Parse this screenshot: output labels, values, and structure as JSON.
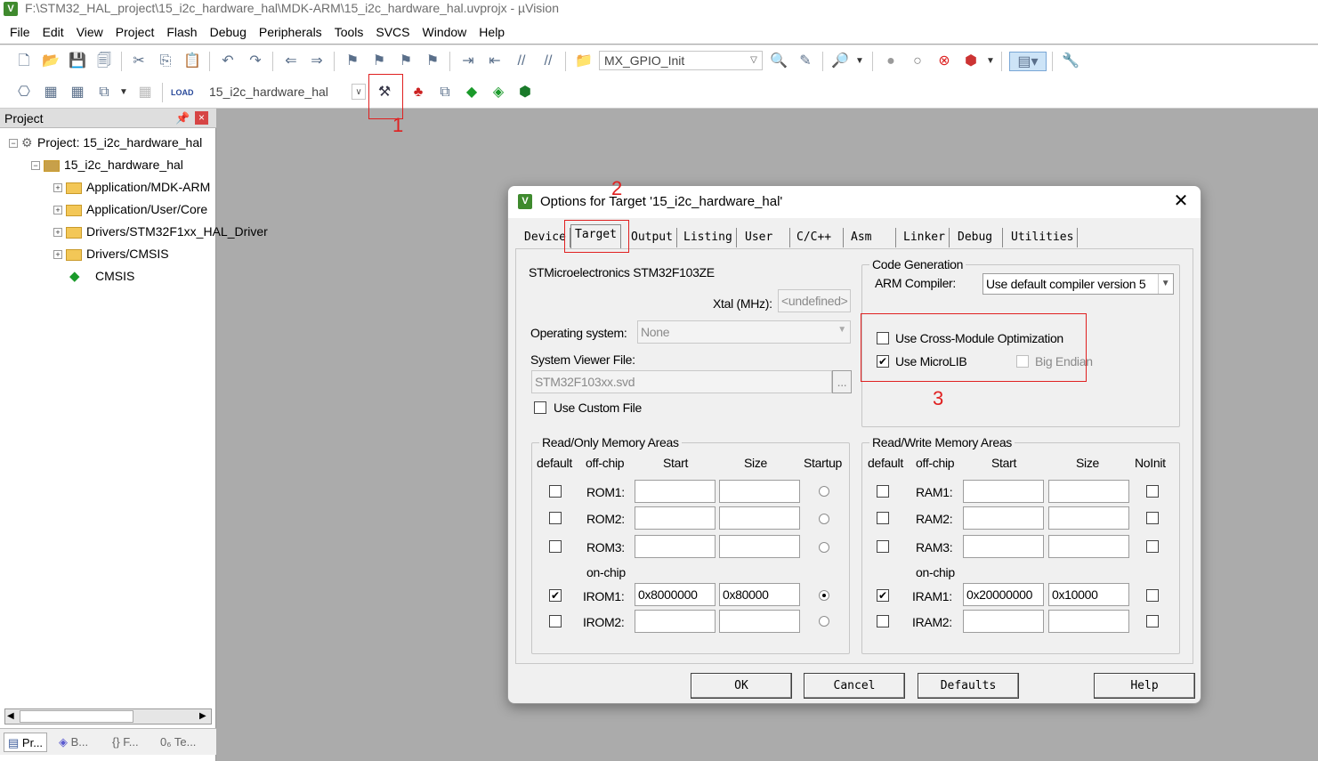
{
  "window": {
    "title": "F:\\STM32_HAL_project\\15_i2c_hardware_hal\\MDK-ARM\\15_i2c_hardware_hal.uvprojx - µVision",
    "icon_text": "V"
  },
  "menu": [
    "File",
    "Edit",
    "View",
    "Project",
    "Flash",
    "Debug",
    "Peripherals",
    "Tools",
    "SVCS",
    "Window",
    "Help"
  ],
  "toolbar": {
    "function_combo": "MX_GPIO_Init",
    "target_combo": "15_i2c_hardware_hal",
    "load_label": "LOAD"
  },
  "project_panel": {
    "title": "Project",
    "pin": "ᵖ",
    "close": "×",
    "tree": [
      {
        "label": "Project: 15_i2c_hardware_hal",
        "expander": "−"
      },
      {
        "label": "15_i2c_hardware_hal",
        "expander": "−"
      },
      {
        "label": "Application/MDK-ARM",
        "expander": "+"
      },
      {
        "label": "Application/User/Core",
        "expander": "+"
      },
      {
        "label": "Drivers/STM32F1xx_HAL_Driver",
        "expander": "+"
      },
      {
        "label": "Drivers/CMSIS",
        "expander": "+"
      },
      {
        "label": "CMSIS",
        "expander": ""
      }
    ],
    "bottom_tabs": [
      "Pr...",
      "B...",
      "{} F...",
      "0₆ Te..."
    ]
  },
  "annotations": [
    "1",
    "2",
    "3"
  ],
  "dialog": {
    "title": "Options for Target '15_i2c_hardware_hal'",
    "close": "✕",
    "tabs": [
      "Device",
      "Target",
      "Output",
      "Listing",
      "User",
      "C/C++",
      "Asm",
      "Linker",
      "Debug",
      "Utilities"
    ],
    "active_tab": "Target",
    "device": "STMicroelectronics STM32F103ZE",
    "xtal_label": "Xtal (MHz):",
    "xtal_value": "<undefined>",
    "os_label": "Operating system:",
    "os_value": "None",
    "svd_label": "System Viewer File:",
    "svd_value": "STM32F103xx.svd",
    "browse": "...",
    "custom_file": "Use Custom File",
    "code_gen": {
      "title": "Code Generation",
      "compiler_label": "ARM Compiler:",
      "compiler_value": "Use default compiler version 5",
      "cross_module": "Use Cross-Module Optimization",
      "microlib": "Use MicroLIB",
      "big_endian": "Big Endian"
    },
    "ro_memory": {
      "title": "Read/Only Memory Areas",
      "headers": [
        "default",
        "off-chip",
        "Start",
        "Size",
        "Startup"
      ],
      "on_chip_label": "on-chip",
      "rows": [
        {
          "name": "ROM1:",
          "start": "",
          "size": ""
        },
        {
          "name": "ROM2:",
          "start": "",
          "size": ""
        },
        {
          "name": "ROM3:",
          "start": "",
          "size": ""
        },
        {
          "name": "IROM1:",
          "start": "0x8000000",
          "size": "0x80000"
        },
        {
          "name": "IROM2:",
          "start": "",
          "size": ""
        }
      ]
    },
    "rw_memory": {
      "title": "Read/Write Memory Areas",
      "headers": [
        "default",
        "off-chip",
        "Start",
        "Size",
        "NoInit"
      ],
      "on_chip_label": "on-chip",
      "rows": [
        {
          "name": "RAM1:",
          "start": "",
          "size": ""
        },
        {
          "name": "RAM2:",
          "start": "",
          "size": ""
        },
        {
          "name": "RAM3:",
          "start": "",
          "size": ""
        },
        {
          "name": "IRAM1:",
          "start": "0x20000000",
          "size": "0x10000"
        },
        {
          "name": "IRAM2:",
          "start": "",
          "size": ""
        }
      ]
    },
    "buttons": {
      "ok": "OK",
      "cancel": "Cancel",
      "defaults": "Defaults",
      "help": "Help"
    }
  }
}
